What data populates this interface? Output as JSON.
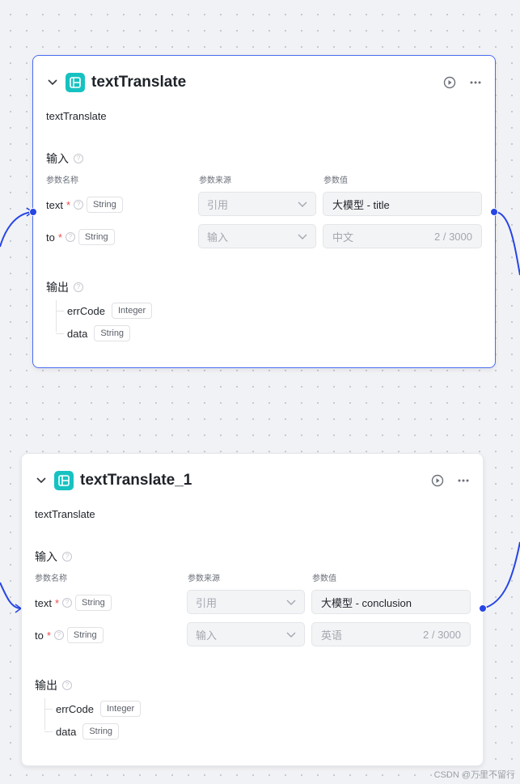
{
  "columns": {
    "name": "参数名称",
    "source": "参数来源",
    "value": "参数值"
  },
  "nodes": [
    {
      "title": "textTranslate",
      "description": "textTranslate",
      "input_label": "输入",
      "output_label": "输出",
      "params": [
        {
          "name": "text",
          "required": "*",
          "type": "String",
          "source": "引用",
          "value": "大模型 - title",
          "count": ""
        },
        {
          "name": "to",
          "required": "*",
          "type": "String",
          "source": "输入",
          "value": "中文",
          "count": "2 / 3000"
        }
      ],
      "outputs": [
        {
          "name": "errCode",
          "type": "Integer"
        },
        {
          "name": "data",
          "type": "String"
        }
      ],
      "selected": true
    },
    {
      "title": "textTranslate_1",
      "description": "textTranslate",
      "input_label": "输入",
      "output_label": "输出",
      "params": [
        {
          "name": "text",
          "required": "*",
          "type": "String",
          "source": "引用",
          "value": "大模型 - conclusion",
          "count": ""
        },
        {
          "name": "to",
          "required": "*",
          "type": "String",
          "source": "输入",
          "value": "英语",
          "count": "2 / 3000"
        }
      ],
      "outputs": [
        {
          "name": "errCode",
          "type": "Integer"
        },
        {
          "name": "data",
          "type": "String"
        }
      ],
      "selected": false
    }
  ],
  "watermark": "CSDN @万里不留行",
  "colors": {
    "accent": "#2745e4",
    "logo": "#16c2c1",
    "required": "#f04a4a",
    "selected_border": "#4a6cf0"
  },
  "icons": [
    "chevron-down-icon",
    "node-logo-icon",
    "run-icon",
    "more-icon",
    "help-icon",
    "chevron-down-icon"
  ]
}
